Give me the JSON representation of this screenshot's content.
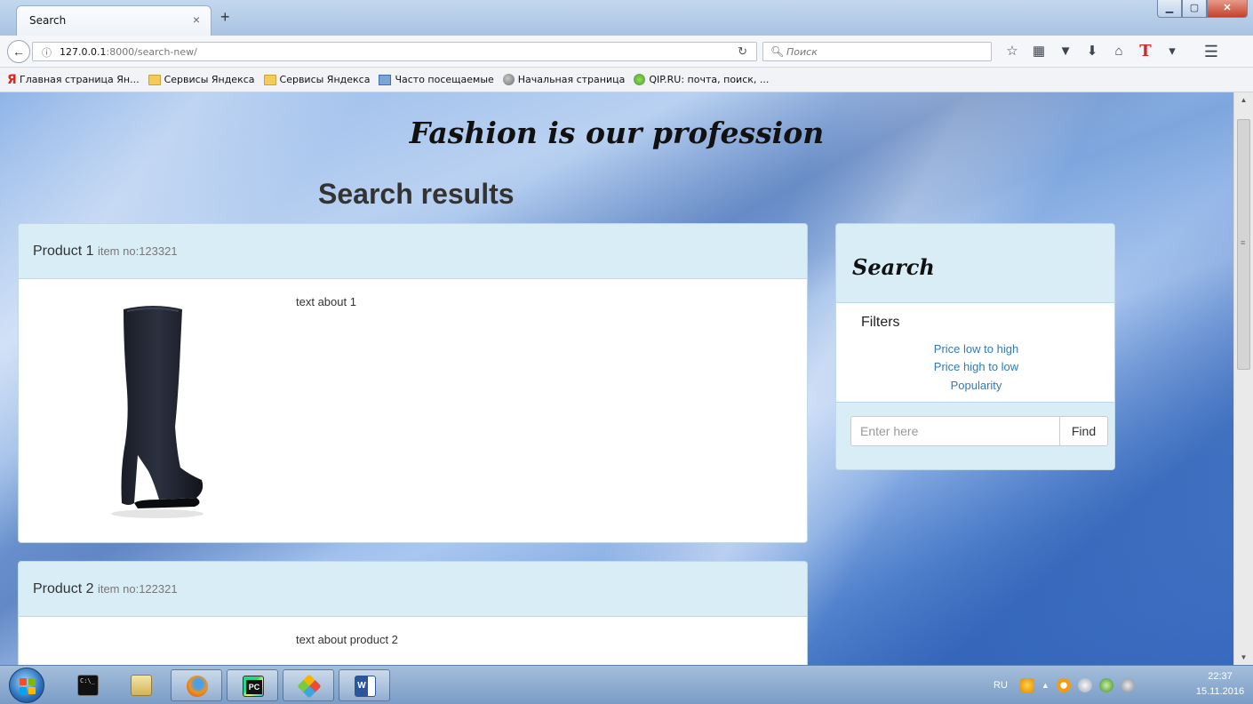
{
  "browser": {
    "tab_title": "Search",
    "tab_close": "×",
    "new_tab": "+",
    "window_buttons": {
      "minimize": "▁",
      "maximize": "▢",
      "close": "✕"
    },
    "url_host": "127.0.0.1",
    "url_rest": ":8000/search-new/",
    "search_placeholder": "Поиск",
    "bookmarks": [
      {
        "label": "Главная страница Ян...",
        "icon": "yandex-icon"
      },
      {
        "label": "Сервисы Яндекса",
        "icon": "folder-icon"
      },
      {
        "label": "Сервисы Яндекса",
        "icon": "folder-icon"
      },
      {
        "label": "Часто посещаемые",
        "icon": "page-icon"
      },
      {
        "label": "Начальная страница",
        "icon": "globe-icon"
      },
      {
        "label": "QIP.RU: почта, поиск, ...",
        "icon": "qip-icon"
      }
    ]
  },
  "page": {
    "site_title": "Fashion is our profession",
    "heading": "Search results",
    "products": [
      {
        "name": "Product 1",
        "item_prefix": "item no:",
        "item_no": "123321",
        "text": "text about 1"
      },
      {
        "name": "Product 2",
        "item_prefix": "item no:",
        "item_no": "122321",
        "text": "text about product 2"
      }
    ],
    "search_panel": {
      "title": "Search",
      "filters_label": "Filters",
      "filters": [
        "Price low to high",
        "Price high to low",
        "Popularity"
      ],
      "input_placeholder": "Enter here",
      "find_label": "Find"
    }
  },
  "taskbar": {
    "language": "RU",
    "time": "22:37",
    "date": "15.11.2016"
  },
  "colors": {
    "panel_header": "#d9edf7",
    "link": "#337ab7",
    "close_button": "#c4412b"
  }
}
